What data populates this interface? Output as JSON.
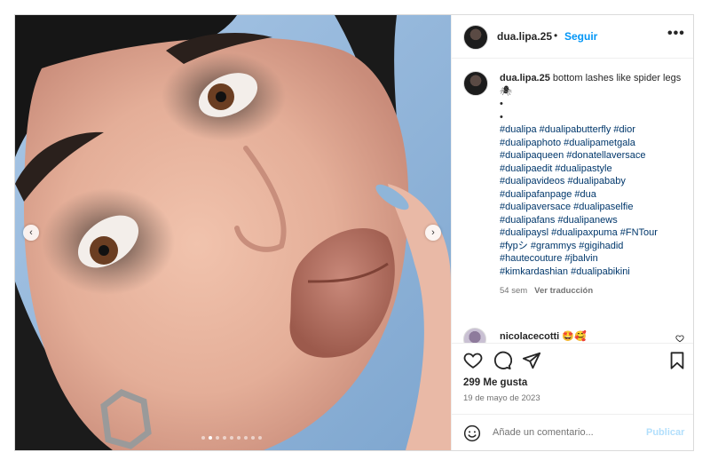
{
  "post": {
    "username": "dua.lipa.25",
    "separator": "•",
    "follow_label": "Seguir",
    "more_label": "•••",
    "caption": {
      "username": "dua.lipa.25",
      "text": "bottom lashes like spider legs 🕷",
      "bullets": [
        "•",
        "•"
      ],
      "hashtag_lines": [
        "#dualipa #dualipabutterfly #dior",
        "#dualipaphoto #dualipametgala",
        "#dualipaqueen #donatellaversace",
        "#dualipaedit #dualipastyle",
        "#dualipavideos #dualipababy",
        "#dualipafanpage #dua",
        "#dualipaversace #dualipaselfie",
        "#dualipafans #dualipanews",
        "#dualipaysl #dualipaxpuma #FNTour",
        "#fypシ #grammys #gigihadid",
        "#hautecouture #jbalvin",
        "#kimkardashian #dualipabikini"
      ],
      "age": "54 sem",
      "translate_label": "Ver traducción"
    },
    "comment": {
      "username": "nicolacecotti",
      "text": "🤩🥰",
      "heart_icon": "heart-outline-icon"
    },
    "likes": "299 Me gusta",
    "date": "19 de mayo de 2023",
    "add_comment": {
      "placeholder": "Añade un comentario...",
      "post_label": "Publicar"
    },
    "carousel": {
      "prev_icon": "‹",
      "next_icon": "›",
      "dot_count": 9,
      "active_dot": 1
    }
  },
  "colors": {
    "follow": "#0095f6",
    "hashtag": "#00376b",
    "muted": "#737373",
    "post_disabled": "#b2dffc"
  }
}
